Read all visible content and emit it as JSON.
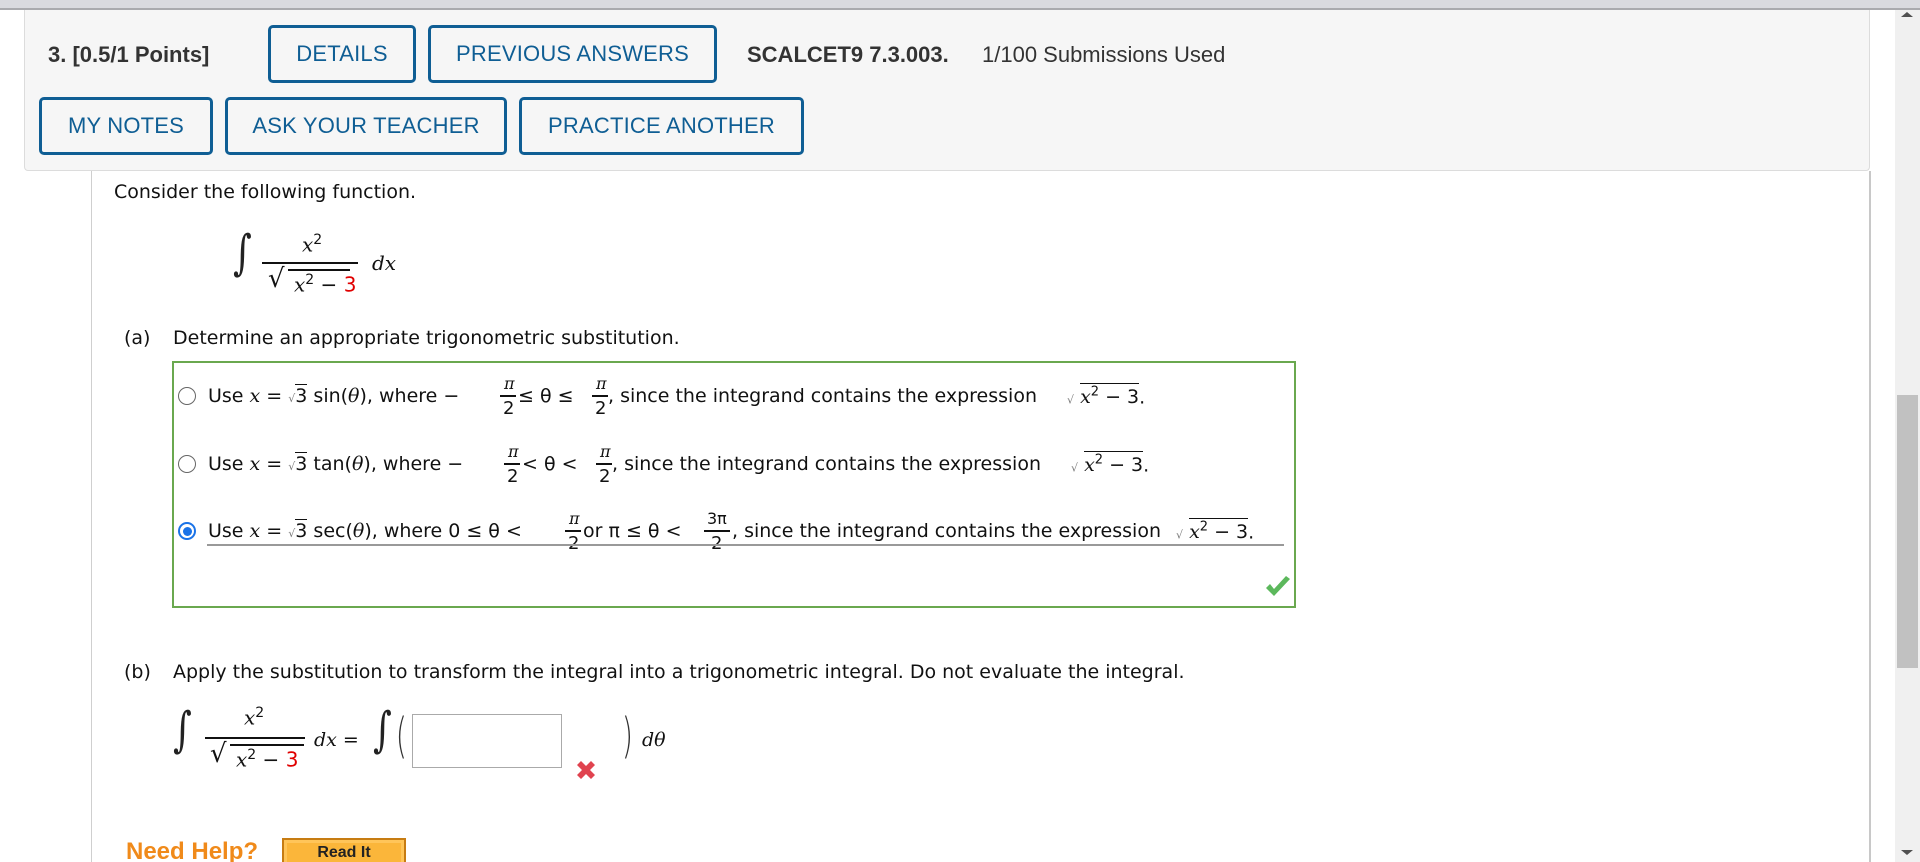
{
  "header": {
    "question_label": "3.  [0.5/1 Points]",
    "buttons": {
      "details": "DETAILS",
      "previous_answers": "PREVIOUS ANSWERS",
      "my_notes": "MY NOTES",
      "ask_teacher": "ASK YOUR TEACHER",
      "practice_another": "PRACTICE ANOTHER"
    },
    "problem_code": "SCALCET9 7.3.003.",
    "submissions": "1/100 Submissions Used"
  },
  "problem": {
    "intro": "Consider the following function.",
    "integral": {
      "numerator": "x",
      "numerator_exp": "2",
      "denominator_var": "x",
      "denominator_exp": "2",
      "denominator_op": " − ",
      "denominator_const": "3",
      "dx": "dx"
    }
  },
  "part_a": {
    "label": "(a)",
    "prompt": "Determine an appropriate trigonometric substitution.",
    "options": [
      {
        "prefix": "Use ",
        "var": "x",
        "eq": " = ",
        "root": "3",
        "func": " sin(",
        "theta": "θ",
        "close": "), where −",
        "frac1_num": "π",
        "frac1_den": "2",
        "mid": " ≤ θ ≤ ",
        "frac2_num": "π",
        "frac2_den": "2",
        "suffix": ", since the integrand contains the expression",
        "expr_var": "x",
        "expr_exp": "2",
        "expr_rest": " − 3",
        "end": ".",
        "selected": false
      },
      {
        "prefix": "Use ",
        "var": "x",
        "eq": " = ",
        "root": "3",
        "func": " tan(",
        "theta": "θ",
        "close": "), where −",
        "frac1_num": "π",
        "frac1_den": "2",
        "mid": " < θ < ",
        "frac2_num": "π",
        "frac2_den": "2",
        "suffix": ", since the integrand contains the expression",
        "expr_var": "x",
        "expr_exp": "2",
        "expr_rest": " − 3",
        "end": ".",
        "selected": false
      },
      {
        "prefix": "Use ",
        "var": "x",
        "eq": " = ",
        "root": "3",
        "func": " sec(",
        "theta": "θ",
        "close": "), where 0 ≤ θ < ",
        "frac1_num": "π",
        "frac1_den": "2",
        "mid": " or π ≤ θ < ",
        "frac2_num": "3π",
        "frac2_den": "2",
        "suffix": ", since the integrand contains the expression",
        "expr_var": "x",
        "expr_exp": "2",
        "expr_rest": " − 3",
        "end": ".",
        "selected": true
      }
    ],
    "status": "correct"
  },
  "part_b": {
    "label": "(b)",
    "prompt": "Apply the substitution to transform the integral into a trigonometric integral. Do not evaluate the integral.",
    "lhs": {
      "numerator": "x",
      "numerator_exp": "2",
      "denominator_var": "x",
      "denominator_exp": "2",
      "denominator_op": " − ",
      "denominator_const": "3",
      "dx": "dx ="
    },
    "answer_value": "",
    "d_theta": "dθ",
    "status": "incorrect"
  },
  "help": {
    "label": "Need Help?",
    "read_it": "Read It"
  },
  "colors": {
    "button_blue": "#0f5e94",
    "correct_green": "#6aa84f",
    "incorrect_red": "#e0434f",
    "help_orange": "#f08a1a",
    "highlight_red": "#e00000"
  }
}
